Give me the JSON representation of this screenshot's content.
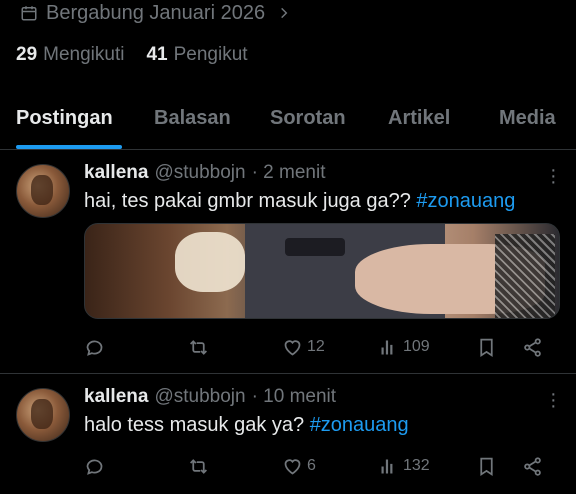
{
  "profile": {
    "joined": "Bergabung Januari 2026",
    "following_count": "29",
    "following_label": "Mengikuti",
    "followers_count": "41",
    "followers_label": "Pengikut"
  },
  "tabs": [
    {
      "label": "Postingan",
      "active": true
    },
    {
      "label": "Balasan",
      "active": false
    },
    {
      "label": "Sorotan",
      "active": false
    },
    {
      "label": "Artikel",
      "active": false
    },
    {
      "label": "Media",
      "active": false
    }
  ],
  "posts": [
    {
      "name": "kallena",
      "handle": "@stubbojn",
      "time": "· 2 menit",
      "text": "hai, tes pakai gmbr masuk juga ga??",
      "hashtag": "#zonauang",
      "likes": "12",
      "views": "109"
    },
    {
      "name": "kallena",
      "handle": "@stubbojn",
      "time": "· 10 menit",
      "text": "halo tess masuk gak ya?",
      "hashtag": "#zonauang",
      "likes": "6",
      "views": "132"
    }
  ],
  "colors": {
    "accent": "#1d9bf0",
    "muted": "#71767b",
    "text": "#e7e9ea",
    "border": "#2f3336"
  },
  "icons": [
    "calendar-icon",
    "chevron-right-icon",
    "more-icon",
    "reply-icon",
    "repost-icon",
    "like-icon",
    "views-icon",
    "bookmark-icon",
    "share-icon"
  ]
}
